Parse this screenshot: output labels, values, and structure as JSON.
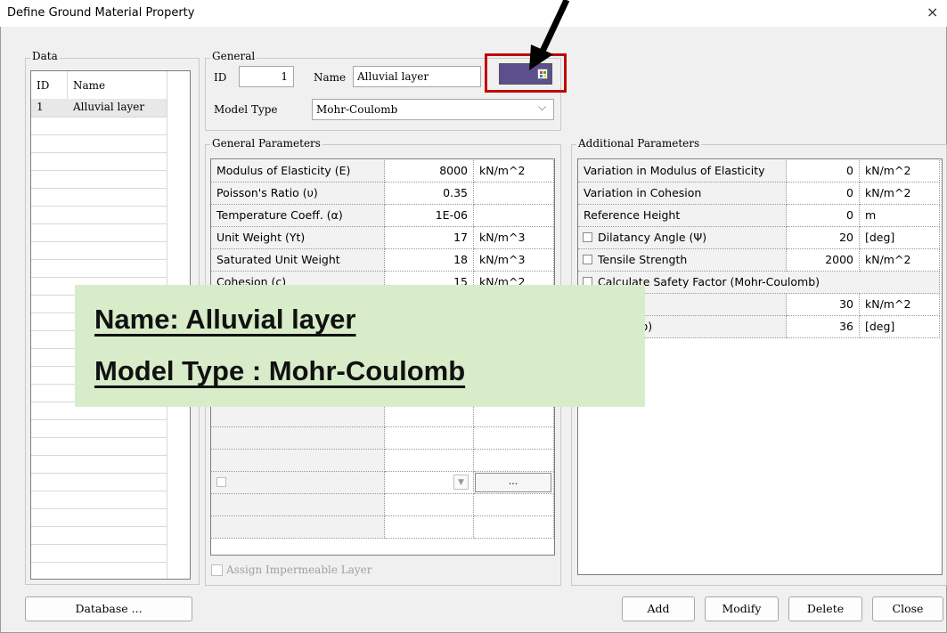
{
  "window": {
    "title": "Define Ground Material Property",
    "close_glyph": "×"
  },
  "data_group": {
    "label": "Data",
    "columns": [
      "ID",
      "Name"
    ],
    "rows": [
      {
        "id": "1",
        "name": "Alluvial layer"
      }
    ],
    "database_button": "Database ..."
  },
  "general": {
    "label": "General",
    "id_label": "ID",
    "id_value": "1",
    "name_label": "Name",
    "name_value": "Alluvial layer",
    "model_type_label": "Model Type",
    "model_type_value": "Mohr-Coulomb",
    "color_swatch": "#5b4f8e",
    "highlight_color": "#c00000"
  },
  "general_params": {
    "label": "General Parameters",
    "rows": [
      {
        "name": "Modulus of Elasticity (E)",
        "value": "8000",
        "unit": "kN/m^2"
      },
      {
        "name": "Poisson's Ratio (υ)",
        "value": "0.35",
        "unit": ""
      },
      {
        "name": "Temperature Coeff. (α)",
        "value": "1E-06",
        "unit": ""
      },
      {
        "name": "Unit Weight (Υt)",
        "value": "17",
        "unit": "kN/m^3"
      },
      {
        "name": "Saturated Unit Weight",
        "value": "18",
        "unit": "kN/m^3"
      },
      {
        "name": "Cohesion (c)",
        "value": "15",
        "unit": "kN/m^2"
      }
    ],
    "ellipsis": "...",
    "impermeable_label": "Assign Impermeable Layer"
  },
  "additional_params": {
    "label": "Additional Parameters",
    "rows": [
      {
        "name": "Variation in Modulus of Elasticity",
        "value": "0",
        "unit": "kN/m^2",
        "checkbox": false
      },
      {
        "name": "Variation in Cohesion",
        "value": "0",
        "unit": "kN/m^2",
        "checkbox": false
      },
      {
        "name": "Reference Height",
        "value": "0",
        "unit": "m",
        "checkbox": false
      },
      {
        "name": "Dilatancy Angle (Ψ)",
        "value": "20",
        "unit": "[deg]",
        "checkbox": true
      },
      {
        "name": "Tensile Strength",
        "value": "2000",
        "unit": "kN/m^2",
        "checkbox": true
      }
    ],
    "safety_label": "Calculate Safety Factor (Mohr-Coulomb)",
    "safety_rows": [
      {
        "name": "",
        "value": "30",
        "unit": "kN/m^2"
      },
      {
        "name": "on Angle (φ)",
        "value": "36",
        "unit": "[deg]"
      }
    ]
  },
  "buttons": {
    "add": "Add",
    "modify": "Modify",
    "delete": "Delete",
    "close": "Close"
  },
  "overlay": {
    "line1": "Name: Alluvial layer",
    "line2": "Model Type : Mohr-Coulomb",
    "background": "#d8ecc9"
  },
  "arrow_color": "#000000"
}
